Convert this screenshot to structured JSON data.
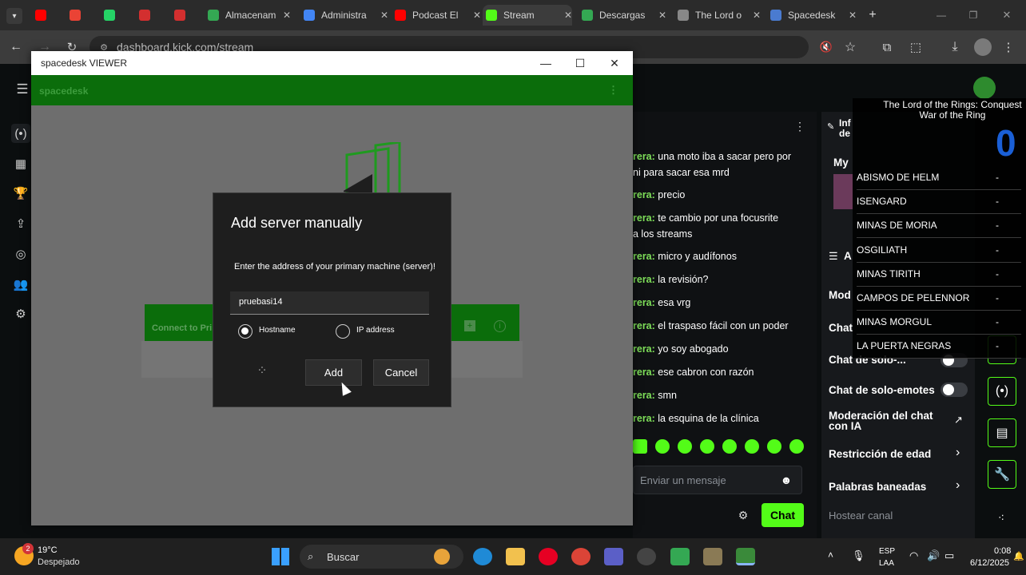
{
  "browser": {
    "tabs": [
      {
        "label": "",
        "color": "#ff0000"
      },
      {
        "label": "",
        "color": "#ea4335"
      },
      {
        "label": "",
        "color": "#25d366"
      },
      {
        "label": "",
        "color": "#d32f2f"
      },
      {
        "label": "",
        "color": "#d32f2f"
      },
      {
        "label": "Almacenam",
        "color": "#34a853"
      },
      {
        "label": "Administra",
        "color": "#4285f4"
      },
      {
        "label": "Podcast El",
        "color": "#ff0000"
      },
      {
        "label": "Stream",
        "color": "#53fc18"
      },
      {
        "label": "Descargas",
        "color": "#34a853"
      },
      {
        "label": "The Lord o",
        "color": "#888888"
      },
      {
        "label": "Spacedesk",
        "color": "#4a7bd0"
      }
    ],
    "url": "dashboard.kick.com/stream"
  },
  "spacedesk": {
    "window_title": "spacedesk VIEWER",
    "brand": "spacedesk",
    "connect_label": "Connect to Pri"
  },
  "dialog": {
    "title": "Add server manually",
    "subtitle": "Enter the address of your primary machine (server)!",
    "field_value": "pruebasi14",
    "radio_hostname": "Hostname",
    "radio_ip": "IP address",
    "add_label": "Add",
    "cancel_label": "Cancel"
  },
  "chat": {
    "messages": [
      {
        "user": "rera:",
        "text": "una moto iba a sacar pero por",
        "cont": "ni para sacar esa mrd"
      },
      {
        "user": "rera:",
        "text": "precio",
        "cont": ""
      },
      {
        "user": "rera:",
        "text": "te cambio por una focusrite",
        "cont": "a los streams"
      },
      {
        "user": "rera:",
        "text": "micro y audífonos",
        "cont": ""
      },
      {
        "user": "rera:",
        "text": "la revisión?",
        "cont": ""
      },
      {
        "user": "rera:",
        "text": "esa vrg",
        "cont": ""
      },
      {
        "user": "rera:",
        "text": "el traspaso fácil con un poder",
        "cont": ""
      },
      {
        "user": "rera:",
        "text": "yo soy abogado",
        "cont": ""
      },
      {
        "user": "rera:",
        "text": "ese cabron con razón",
        "cont": ""
      },
      {
        "user": "rera:",
        "text": "smn",
        "cont": ""
      },
      {
        "user": "rera:",
        "text": "la esquina de la clínica",
        "cont": ""
      }
    ],
    "input_placeholder": "Enviar un mensaje",
    "send_label": "Chat"
  },
  "mod_panel": {
    "info_label": "Inf de",
    "my_label": "My",
    "section_a": "A",
    "mode_label": "Mod",
    "chat_label": "Chat",
    "items": [
      {
        "label": "Chat de solo-...",
        "type": "toggle"
      },
      {
        "label": "Chat de solo-emotes",
        "type": "toggle"
      },
      {
        "label": "Moderación del chat con IA",
        "type": "link"
      },
      {
        "label": "Restricción de edad",
        "type": "chevron"
      },
      {
        "label": "Palabras baneadas",
        "type": "chevron"
      }
    ],
    "host_label": "Hostear canal"
  },
  "overlay": {
    "title": "The Lord of the Rings: Conquest War of the Ring",
    "big_number": "0",
    "rows": [
      {
        "name": "ABISMO DE HELM",
        "value": "-"
      },
      {
        "name": "ISENGARD",
        "value": "-"
      },
      {
        "name": "MINAS DE MORIA",
        "value": "-"
      },
      {
        "name": "OSGILIATH",
        "value": "-"
      },
      {
        "name": "MINAS TIRITH",
        "value": "-"
      },
      {
        "name": "CAMPOS DE PELENNOR",
        "value": "-"
      },
      {
        "name": "MINAS MORGUL",
        "value": "-"
      },
      {
        "name": "LA PUERTA NEGRAS",
        "value": "-"
      }
    ]
  },
  "taskbar": {
    "weather_temp": "19°C",
    "weather_desc": "Despejado",
    "weather_badge": "2",
    "search_placeholder": "Buscar",
    "lang": "ESP",
    "lang_sub": "LAA",
    "time": "0:08",
    "date": "6/12/2025"
  }
}
